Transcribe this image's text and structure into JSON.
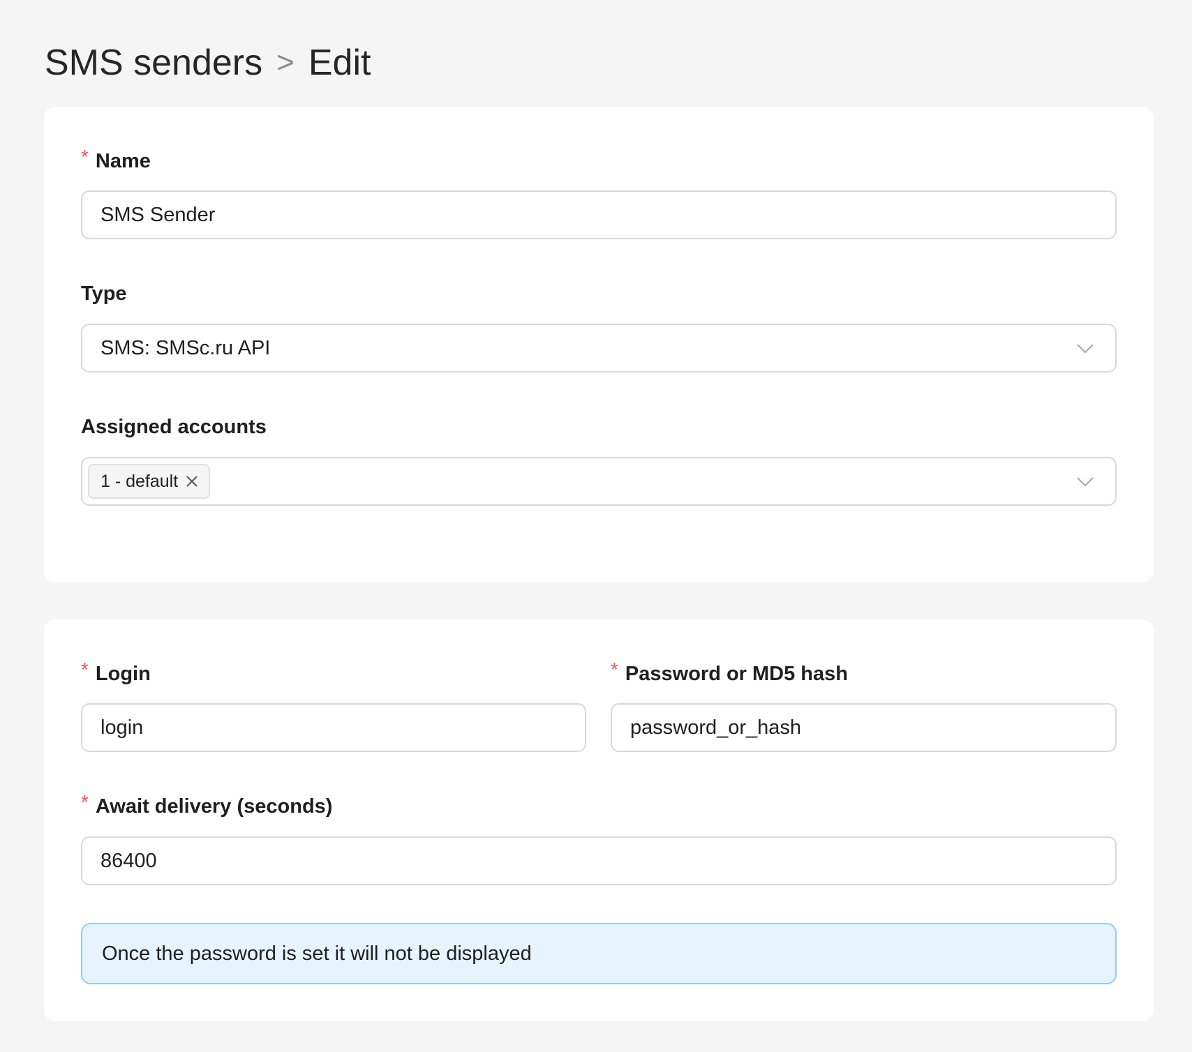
{
  "breadcrumb": {
    "parent": "SMS senders",
    "separator": ">",
    "current": "Edit"
  },
  "general": {
    "name": {
      "label": "Name",
      "required_mark": "*",
      "value": "SMS Sender"
    },
    "type": {
      "label": "Type",
      "value": "SMS: SMSc.ru API"
    },
    "assigned_accounts": {
      "label": "Assigned accounts",
      "tags": [
        "1 - default"
      ]
    }
  },
  "credentials": {
    "login": {
      "label": "Login",
      "required_mark": "*",
      "value": "login"
    },
    "password": {
      "label": "Password or MD5 hash",
      "required_mark": "*",
      "value": "password_or_hash"
    },
    "await_delivery": {
      "label": "Await delivery (seconds)",
      "required_mark": "*",
      "value": "86400"
    },
    "notice": "Once the password is set it will not be displayed"
  },
  "colors": {
    "background": "#f5f5f5",
    "card": "#ffffff",
    "required": "#ff4d4f",
    "input_border": "#d9d9d9",
    "info_bg": "#e6f4ff",
    "info_border": "#91caff"
  },
  "icons": {
    "select_arrow": "chevron-down-icon",
    "tag_remove": "close-icon"
  }
}
